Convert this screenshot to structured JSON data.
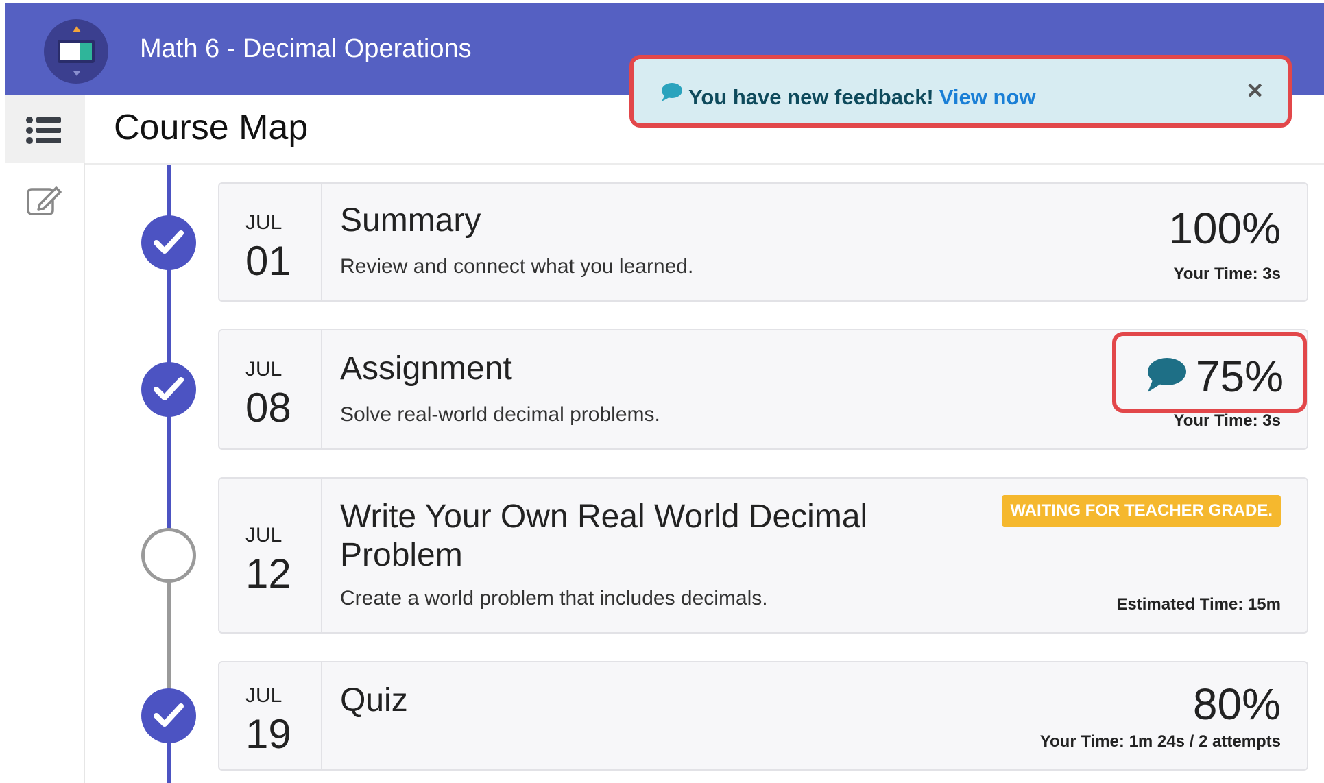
{
  "header": {
    "app_title": "Math 6 - Decimal Operations",
    "logo_icon": "course-logo-icon",
    "background": "#5560c2"
  },
  "sidebar": {
    "items": [
      {
        "icon": "list-icon",
        "selected": true
      },
      {
        "icon": "edit-icon",
        "selected": false
      }
    ]
  },
  "page": {
    "title": "Course Map"
  },
  "toast": {
    "message": "You have new feedback!",
    "link_label": "View now",
    "close_label": "×",
    "icon": "speech-bubble-icon"
  },
  "timeline": [
    {
      "month": "JUL",
      "day": "01",
      "title": "Summary",
      "description": "Review and connect what you learned.",
      "score": "100%",
      "time": "Your Time: 3s",
      "status": "complete"
    },
    {
      "month": "JUL",
      "day": "08",
      "title": "Assignment",
      "description": "Solve real-world decimal problems.",
      "score": "75%",
      "time": "Your Time: 3s",
      "status": "complete",
      "has_feedback": true
    },
    {
      "month": "JUL",
      "day": "12",
      "title_line1": "Write Your Own Real World Decimal",
      "title_line2": "Problem",
      "description": "Create a world problem that includes decimals.",
      "badge": "WAITING FOR TEACHER GRADE.",
      "time": "Estimated Time: 15m",
      "status": "pending"
    },
    {
      "month": "JUL",
      "day": "19",
      "title": "Quiz",
      "score": "80%",
      "time": "Your Time: 1m 24s / 2 attempts",
      "status": "complete"
    }
  ],
  "colors": {
    "accent": "#4c53c2",
    "highlight_border": "#e2474a",
    "badge": "#f5b82e",
    "feedback_bubble": "#1e6f86"
  }
}
